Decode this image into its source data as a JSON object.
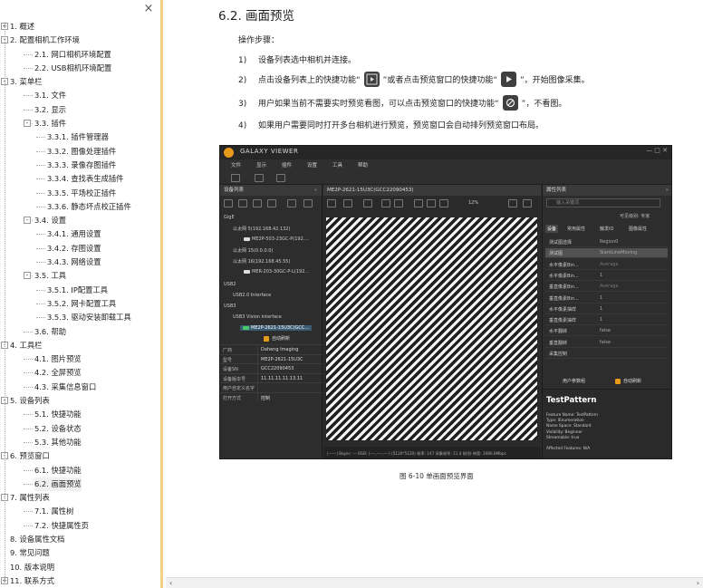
{
  "toc": {
    "close_glyph": "×",
    "items": [
      {
        "label": "1. 概述",
        "level": 0,
        "expander": "+"
      },
      {
        "label": "2. 配置相机工作环境",
        "level": 0,
        "expander": "-"
      },
      {
        "label": "2.1. 网口相机环境配置",
        "level": 1
      },
      {
        "label": "2.2. USB相机环境配置",
        "level": 1
      },
      {
        "label": "3. 菜单栏",
        "level": 0,
        "expander": "-"
      },
      {
        "label": "3.1. 文件",
        "level": 1
      },
      {
        "label": "3.2. 显示",
        "level": 1
      },
      {
        "label": "3.3. 插件",
        "level": 1,
        "expander": "-"
      },
      {
        "label": "3.3.1. 插件管理器",
        "level": 2
      },
      {
        "label": "3.3.2. 图像处理插件",
        "level": 2
      },
      {
        "label": "3.3.3. 录像存图插件",
        "level": 2
      },
      {
        "label": "3.3.4. 查找表生成插件",
        "level": 2
      },
      {
        "label": "3.3.5. 平场校正插件",
        "level": 2
      },
      {
        "label": "3.3.6. 静态坏点校正插件",
        "level": 2
      },
      {
        "label": "3.4. 设置",
        "level": 1,
        "expander": "-"
      },
      {
        "label": "3.4.1. 通用设置",
        "level": 2
      },
      {
        "label": "3.4.2. 存图设置",
        "level": 2
      },
      {
        "label": "3.4.3. 网络设置",
        "level": 2
      },
      {
        "label": "3.5. 工具",
        "level": 1,
        "expander": "-"
      },
      {
        "label": "3.5.1. IP配置工具",
        "level": 2
      },
      {
        "label": "3.5.2. 网卡配置工具",
        "level": 2
      },
      {
        "label": "3.5.3. 驱动安装卸载工具",
        "level": 2
      },
      {
        "label": "3.6. 帮助",
        "level": 1
      },
      {
        "label": "4. 工具栏",
        "level": 0,
        "expander": "-"
      },
      {
        "label": "4.1. 图片预览",
        "level": 1
      },
      {
        "label": "4.2. 全屏预览",
        "level": 1
      },
      {
        "label": "4.3. 采集信息窗口",
        "level": 1
      },
      {
        "label": "5. 设备列表",
        "level": 0,
        "expander": "-"
      },
      {
        "label": "5.1. 快捷功能",
        "level": 1
      },
      {
        "label": "5.2. 设备状态",
        "level": 1
      },
      {
        "label": "5.3. 其他功能",
        "level": 1
      },
      {
        "label": "6. 预览窗口",
        "level": 0,
        "expander": "-"
      },
      {
        "label": "6.1. 快捷功能",
        "level": 1
      },
      {
        "label": "6.2. 画面预览",
        "level": 1,
        "selected": true
      },
      {
        "label": "7. 属性列表",
        "level": 0,
        "expander": "-"
      },
      {
        "label": "7.1. 属性树",
        "level": 1
      },
      {
        "label": "7.2. 快捷属性页",
        "level": 1
      },
      {
        "label": "8. 设备属性文档",
        "level": 0
      },
      {
        "label": "9. 常见问题",
        "level": 0
      },
      {
        "label": "10. 版本说明",
        "level": 0
      },
      {
        "label": "11. 联系方式",
        "level": 0,
        "expander": "+"
      }
    ]
  },
  "doc": {
    "section_title": "6.2. 画面预览",
    "intro": "操作步骤：",
    "steps": [
      {
        "num": "1)",
        "text": "设备列表选中相机并连接。"
      },
      {
        "num": "2)",
        "text_a": "点击设备列表上的快捷功能“",
        "text_b": "”或者点击预览窗口的快捷功能“",
        "text_c": "”，开始图像采集。"
      },
      {
        "num": "3)",
        "text_a": "用户如果当前不需要实时预览看图，可以点击预览窗口的快捷功能“",
        "text_b": "”，不看图。"
      },
      {
        "num": "4)",
        "text": "如果用户需要同时打开多台相机进行预览，预览窗口会自动排列预览窗口布局。"
      }
    ],
    "caption": "图 6-10 单画面预览界面"
  },
  "screenshot": {
    "app_title": "GALAXY VIEWER",
    "window_buttons": "—  □  ✕",
    "menu": [
      "文件",
      "显示",
      "插件",
      "设置",
      "工具",
      "帮助"
    ],
    "device_panel": {
      "title": "设备列表",
      "collapse": "«",
      "tree": [
        "GigE",
        "以太网 5(192.168.42.132)",
        "ME2P-503-23GC-P(192....",
        "以太网 15(0.0.0.0)",
        "以太网 16(192.168.45.55)",
        "MER-203-30GC-P-L(192...",
        "USB2",
        "USB2.0 Interface",
        "USB3",
        "USB3 Vision interface",
        "ME2P-2621-15U3C(GCC..."
      ],
      "auto_refresh": "自动刷新",
      "info": [
        {
          "k": "厂商",
          "v": "Daheng Imaging"
        },
        {
          "k": "型号",
          "v": "ME2P-2621-15U3C"
        },
        {
          "k": "设备SN",
          "v": "GCC22090453"
        },
        {
          "k": "设备版本号",
          "v": "11.11.11.11.13.11"
        },
        {
          "k": "用户自定义名字",
          "v": ""
        },
        {
          "k": "打开方式",
          "v": "控制"
        }
      ]
    },
    "view_panel": {
      "title": "ME2P-2621-15U3C(GCC22090453)",
      "zoom": "12%",
      "status": "|------|  Bayer: ---  RGB: (----,----,----)  (5120*5120) 帧率: 147  采集帧率: 11.4 帧/秒  带宽: 2086.8Mbps"
    },
    "prop_panel": {
      "title": "属性列表",
      "collapse": "»",
      "search_placeholder": "输入关键词",
      "visibility": "可见级别: 专家",
      "tabs": [
        "设备",
        "常用属性",
        "触发IO",
        "图像属性"
      ],
      "rows": [
        {
          "k": "测试图选择",
          "v": "Region0",
          "dim": false,
          "hl": false
        },
        {
          "k": "测试图",
          "v": "SlantLineMoving",
          "dim": false,
          "hl": true
        },
        {
          "k": "水平像素Bin...",
          "v": "Average",
          "dim": true,
          "hl": false
        },
        {
          "k": "水平像素Bin...",
          "v": "1",
          "dim": false,
          "hl": false
        },
        {
          "k": "垂直像素Bin...",
          "v": "Average",
          "dim": true,
          "hl": false
        },
        {
          "k": "垂直像素Bin...",
          "v": "1",
          "dim": false,
          "hl": false
        },
        {
          "k": "水平像素抽样",
          "v": "1",
          "dim": false,
          "hl": false
        },
        {
          "k": "垂直像素抽样",
          "v": "1",
          "dim": false,
          "hl": false
        },
        {
          "k": "水平翻转",
          "v": "false",
          "dim": false,
          "hl": false
        },
        {
          "k": "垂直翻转",
          "v": "false",
          "dim": false,
          "hl": false
        },
        {
          "k": "采集控制",
          "v": "",
          "dim": false,
          "hl": false
        }
      ],
      "user_params": "用户参数组",
      "auto_refresh": "自动刷新",
      "desc_title": "TestPattern",
      "desc_lines": [
        "Feature Name: TestPattern",
        "Type: IEnumeration",
        "Name Space: Standard",
        "Visibility: Beginner",
        "Streamable: true",
        "",
        "Affected Features: N/A"
      ]
    }
  },
  "hscroll": {
    "left": "‹",
    "right": "›"
  }
}
